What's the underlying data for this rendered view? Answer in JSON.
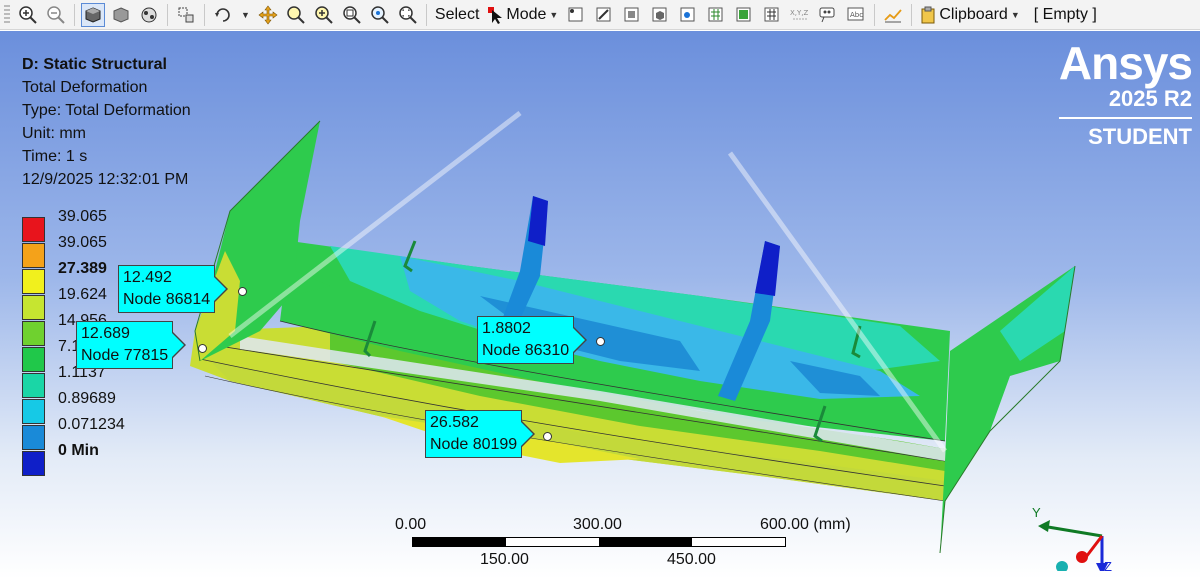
{
  "toolbar": {
    "select_label": "Select",
    "mode_label": "Mode",
    "clipboard_label": "Clipboard",
    "empty_label": "[ Empty ]"
  },
  "info": {
    "title": "D: Static Structural",
    "result": "Total Deformation",
    "type": "Type: Total Deformation",
    "unit": "Unit: mm",
    "time": "Time: 1 s",
    "timestamp": "12/9/2025 12:32:01 PM"
  },
  "legend": [
    {
      "label": "39.065",
      "color": "#e8141c",
      "bold": false
    },
    {
      "label": "39.065",
      "color": "#f4a21a",
      "bold": false
    },
    {
      "label": "27.389",
      "color": "#f1f01d",
      "bold": true
    },
    {
      "label": "19.624",
      "color": "#c6e530",
      "bold": false
    },
    {
      "label": "14.956",
      "color": "#6fd12f",
      "bold": false
    },
    {
      "label": "7.1",
      "color": "#20c84a",
      "bold": false
    },
    {
      "label": "1.1137",
      "color": "#1ad6a6",
      "bold": false
    },
    {
      "label": "0.89689",
      "color": "#16c9e6",
      "bold": false
    },
    {
      "label": "0.071234",
      "color": "#1a8ad8",
      "bold": false
    },
    {
      "label": "0 Min",
      "color": "#0f1fc8",
      "bold": true
    }
  ],
  "probes": [
    {
      "value": "12.492",
      "node": "Node 86814"
    },
    {
      "value": "12.689",
      "node": "Node 77815"
    },
    {
      "value": "1.8802",
      "node": "Node 86310"
    },
    {
      "value": "26.582",
      "node": "Node 80199"
    }
  ],
  "brand": {
    "logo": "Ansys",
    "version": "2025 R2",
    "edition": "STUDENT"
  },
  "scale": {
    "top": [
      "0.00",
      "300.00",
      "600.00 (mm)"
    ],
    "bottom": [
      "150.00",
      "450.00"
    ]
  },
  "triad": {
    "y": "Y",
    "z": "Z"
  },
  "colors": {
    "probe_bg": "#00ffff",
    "viewport_top": "#6b8fdc"
  }
}
